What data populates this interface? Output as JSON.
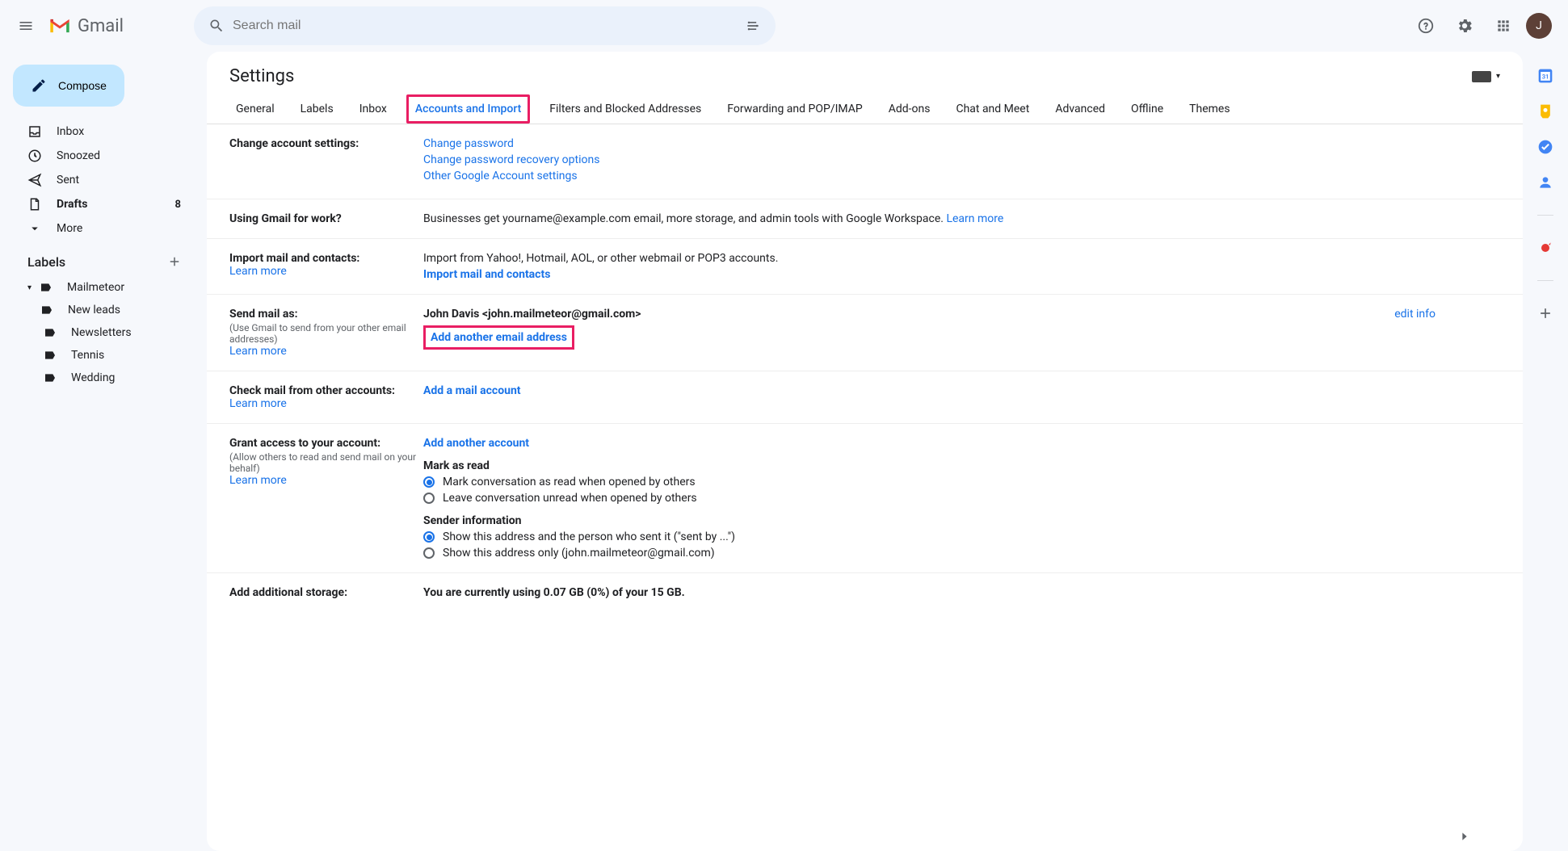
{
  "header": {
    "logo_text": "Gmail",
    "search_placeholder": "Search mail",
    "avatar_initial": "J"
  },
  "sidebar": {
    "compose": "Compose",
    "items": [
      {
        "label": "Inbox",
        "count": ""
      },
      {
        "label": "Snoozed",
        "count": ""
      },
      {
        "label": "Sent",
        "count": ""
      },
      {
        "label": "Drafts",
        "count": "8"
      },
      {
        "label": "More",
        "count": ""
      }
    ],
    "labels_header": "Labels",
    "labels": [
      {
        "label": "Mailmeteor"
      },
      {
        "label": "New leads"
      },
      {
        "label": "Newsletters"
      },
      {
        "label": "Tennis"
      },
      {
        "label": "Wedding"
      }
    ]
  },
  "settings": {
    "title": "Settings",
    "tabs": [
      "General",
      "Labels",
      "Inbox",
      "Accounts and Import",
      "Filters and Blocked Addresses",
      "Forwarding and POP/IMAP",
      "Add-ons",
      "Chat and Meet",
      "Advanced",
      "Offline",
      "Themes"
    ]
  },
  "sections": {
    "change_account": {
      "title": "Change account settings:",
      "links": [
        "Change password",
        "Change password recovery options",
        "Other Google Account settings"
      ]
    },
    "work": {
      "title": "Using Gmail for work?",
      "text": "Businesses get yourname@example.com email, more storage, and admin tools with Google Workspace. ",
      "learn": "Learn more"
    },
    "import": {
      "title": "Import mail and contacts:",
      "learn": "Learn more",
      "text": "Import from Yahoo!, Hotmail, AOL, or other webmail or POP3 accounts.",
      "action": "Import mail and contacts"
    },
    "send_as": {
      "title": "Send mail as:",
      "sub": "(Use Gmail to send from your other email addresses)",
      "learn": "Learn more",
      "identity": "John Davis <john.mailmeteor@gmail.com>",
      "edit": "edit info",
      "add": "Add another email address"
    },
    "check_mail": {
      "title": "Check mail from other accounts:",
      "learn": "Learn more",
      "action": "Add a mail account"
    },
    "grant": {
      "title": "Grant access to your account:",
      "sub": "(Allow others to read and send mail on your behalf)",
      "learn": "Learn more",
      "action": "Add another account",
      "mark_title": "Mark as read",
      "mark_opt1": "Mark conversation as read when opened by others",
      "mark_opt2": "Leave conversation unread when opened by others",
      "sender_title": "Sender information",
      "sender_opt1": "Show this address and the person who sent it (\"sent by ...\")",
      "sender_opt2": "Show this address only (john.mailmeteor@gmail.com)"
    },
    "storage": {
      "title": "Add additional storage:",
      "text": "You are currently using 0.07 GB (0%) of your 15 GB."
    }
  }
}
